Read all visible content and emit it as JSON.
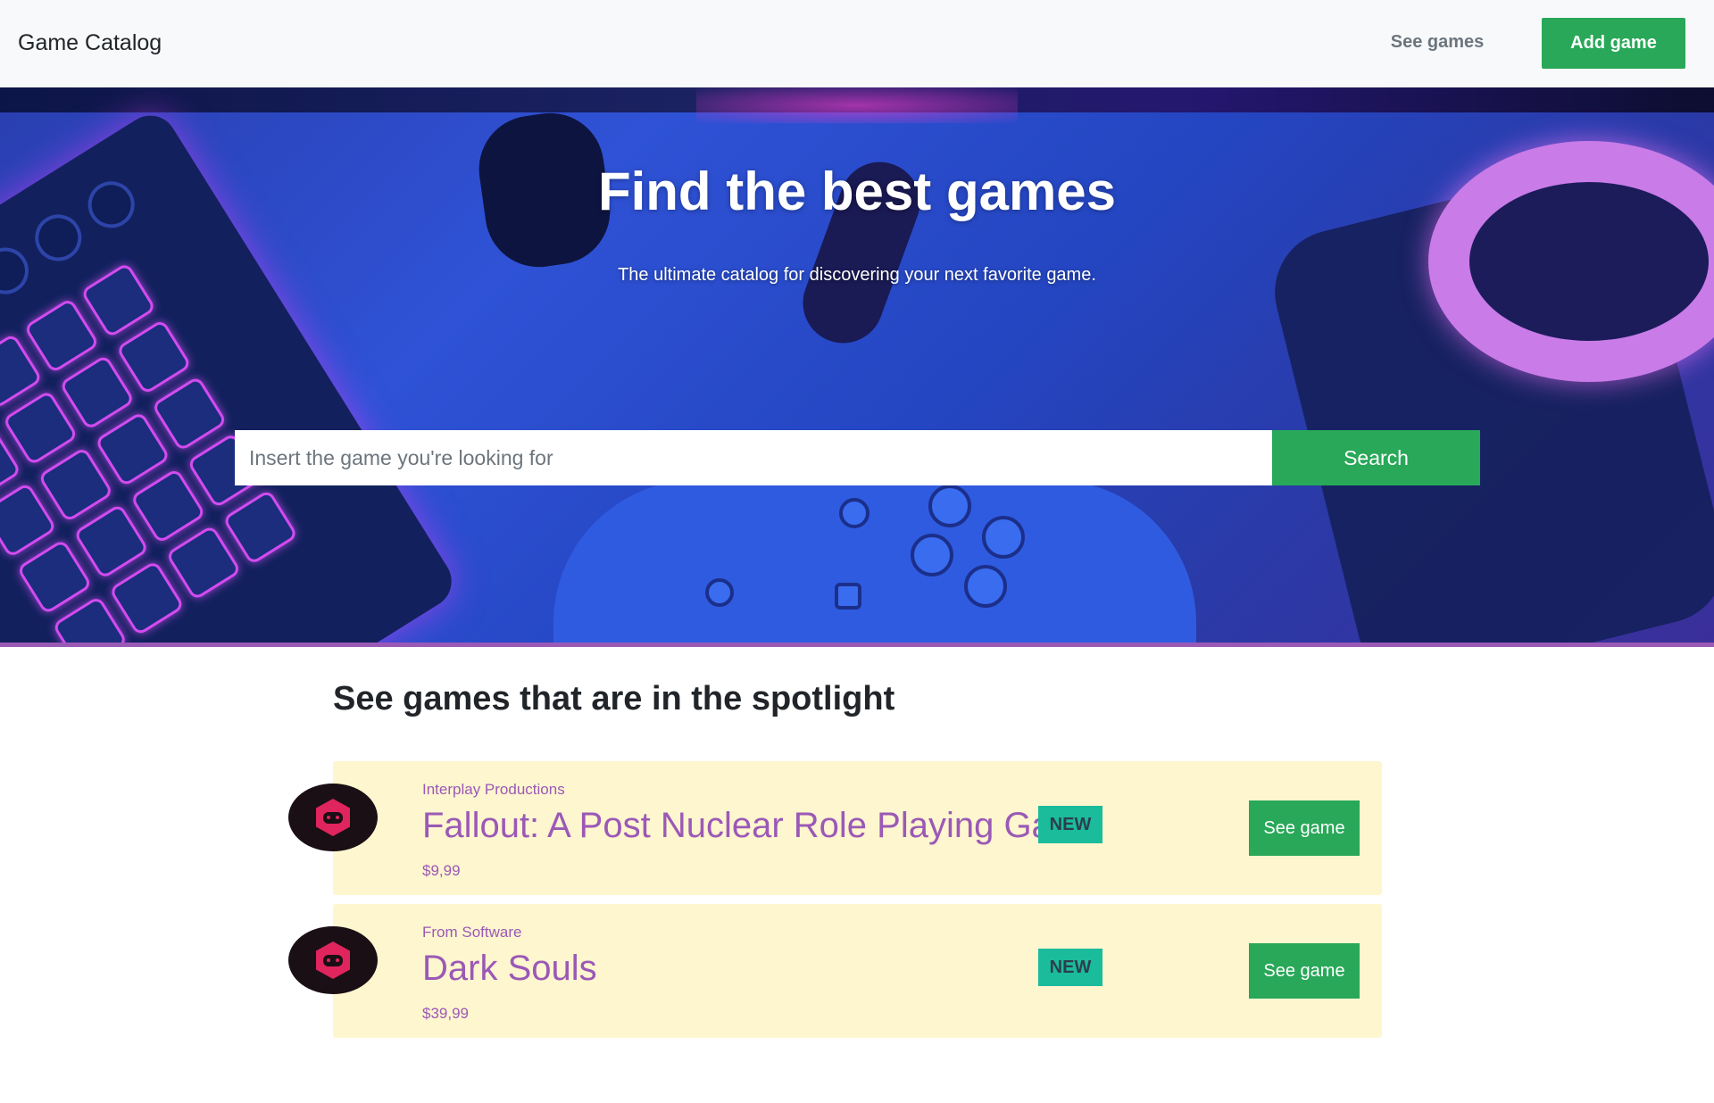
{
  "navbar": {
    "brand": "Game Catalog",
    "see_games": "See games",
    "add_game": "Add game"
  },
  "hero": {
    "title": "Find the best games",
    "subtitle": "The ultimate catalog for discovering your next favorite game.",
    "search_placeholder": "Insert the game you're looking for",
    "search_button": "Search"
  },
  "spotlight": {
    "title": "See games that are in the spotlight",
    "games": [
      {
        "publisher": "Interplay Productions",
        "title": "Fallout: A Post Nuclear Role Playing Game",
        "price": "$9,99",
        "badge": "NEW",
        "button": "See game"
      },
      {
        "publisher": "From Software",
        "title": "Dark Souls",
        "price": "$39,99",
        "badge": "NEW",
        "button": "See game"
      }
    ]
  },
  "colors": {
    "accent_green": "#28a858",
    "purple": "#9b59b6",
    "badge_teal": "#1abc9c",
    "card_bg": "#fef6cf"
  },
  "icons": {
    "game_avatar": "gamepad-hexagon-icon"
  }
}
